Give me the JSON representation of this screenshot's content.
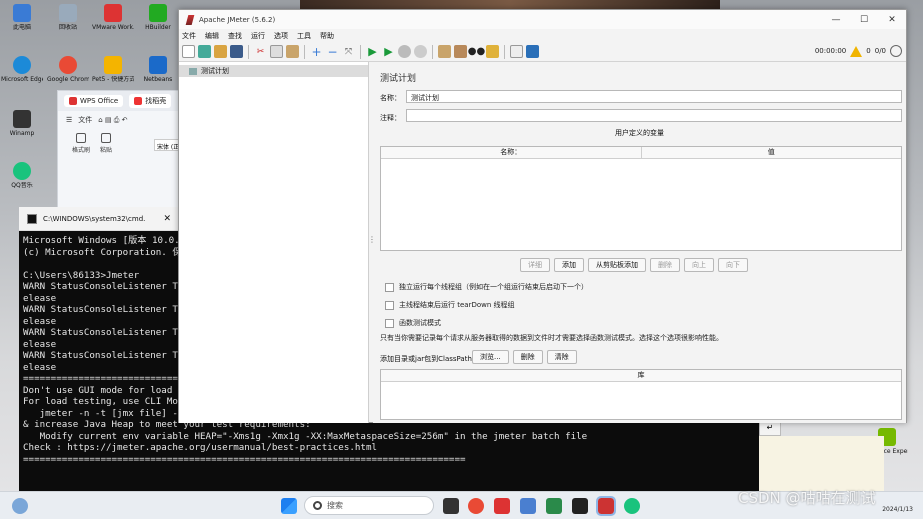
{
  "desktop": {
    "icons": [
      {
        "label": "此电脑",
        "color": "#3a7bd5"
      },
      {
        "label": "回收站",
        "color": "#9ab"
      },
      {
        "label": "VMware Work...",
        "color": "#d33"
      },
      {
        "label": "HBuilder",
        "color": "#2a2"
      },
      {
        "label": "Microsoft Edge",
        "color": "#1c8ad8"
      },
      {
        "label": "Google Chrome",
        "color": "#e94a35"
      },
      {
        "label": "Pet5 - 快捷方式",
        "color": "#f4b400"
      },
      {
        "label": "Netbeans",
        "color": "#1b6ac9"
      },
      {
        "label": "Winamp",
        "color": "#333"
      },
      {
        "label": "QQ音乐",
        "color": "#19c37d"
      },
      {
        "label": "GeForce Experience",
        "color": "#76b900"
      }
    ]
  },
  "wps": {
    "tab1": "WPS Office",
    "tab2": "找稻壳",
    "menu_file": "文件",
    "tool1": "格式刷",
    "tool2": "粘贴",
    "font": "宋体 (正"
  },
  "cmd": {
    "title": "C:\\WINDOWS\\system32\\cmd.",
    "lines": [
      "Microsoft Windows [版本 10.0.19045]",
      "(c) Microsoft Corporation. 保留所有权利。",
      "",
      "C:\\Users\\86133>Jmeter",
      "WARN StatusConsoleListener The use of package scanning to locate plugins is deprecated and will be removed in a future r",
      "elease",
      "WARN StatusConsoleListener The use of package scanning to locate plugins is deprecated and will be removed in a future r",
      "elease",
      "WARN StatusConsoleListener The use of package scanning to locate plugins is deprecated and will be removed in a future r",
      "elease",
      "WARN StatusConsoleListener The use of package scanning to locate plugins is deprecated and will be removed in a future r",
      "elease",
      "================================================================================",
      "Don't use GUI mode for load testing !, only for Test creation and Test debugging.",
      "For load testing, use CLI Mode (was NON GUI):",
      "   jmeter -n -t [jmx file] -l [results file] -e -o [Path to web report folder]",
      "& increase Java Heap to meet your test requirements:",
      "   Modify current env variable HEAP=\"-Xms1g -Xmx1g -XX:MaxMetaspaceSize=256m\" in the jmeter batch file",
      "Check : https://jmeter.apache.org/usermanual/best-practices.html",
      "================================================================================"
    ]
  },
  "jmeter": {
    "title": "Apache JMeter (5.6.2)",
    "menu": [
      "文件",
      "编辑",
      "查找",
      "运行",
      "选项",
      "工具",
      "帮助"
    ],
    "toolbar": {
      "timer": "00:00:00",
      "warn_count": "0",
      "threads": "0/0"
    },
    "tree_node": "测试计划",
    "heading": "测试计划",
    "name_label": "名称：",
    "name_value": "测试计划",
    "comment_label": "注释：",
    "comment_value": "",
    "user_vars": "用户定义的变量",
    "col_name": "名称：",
    "col_value": "值",
    "buttons": {
      "detail": "详细",
      "add": "添加",
      "add_clipboard": "从剪贴板添加",
      "delete": "删除",
      "up": "向上",
      "down": "向下"
    },
    "chk1": "独立运行每个线程组（例如在一个组运行结束后启动下一个）",
    "chk2": "主线程结束后运行 tearDown 线程组",
    "chk3": "函数测试模式",
    "note": "只有当你需要记录每个请求从服务器取得的数据到文件时才需要选择函数测试模式。选择这个选项很影响性能。",
    "classpath_label": "添加目录或jar包到ClassPath",
    "browse": "浏览...",
    "cp_delete": "删除",
    "cp_clear": "清除",
    "lib_header": "库"
  },
  "taskbar": {
    "search_placeholder": "搜索",
    "date": "2024/1/13"
  },
  "watermark": "CSDN @咕咕在测试"
}
